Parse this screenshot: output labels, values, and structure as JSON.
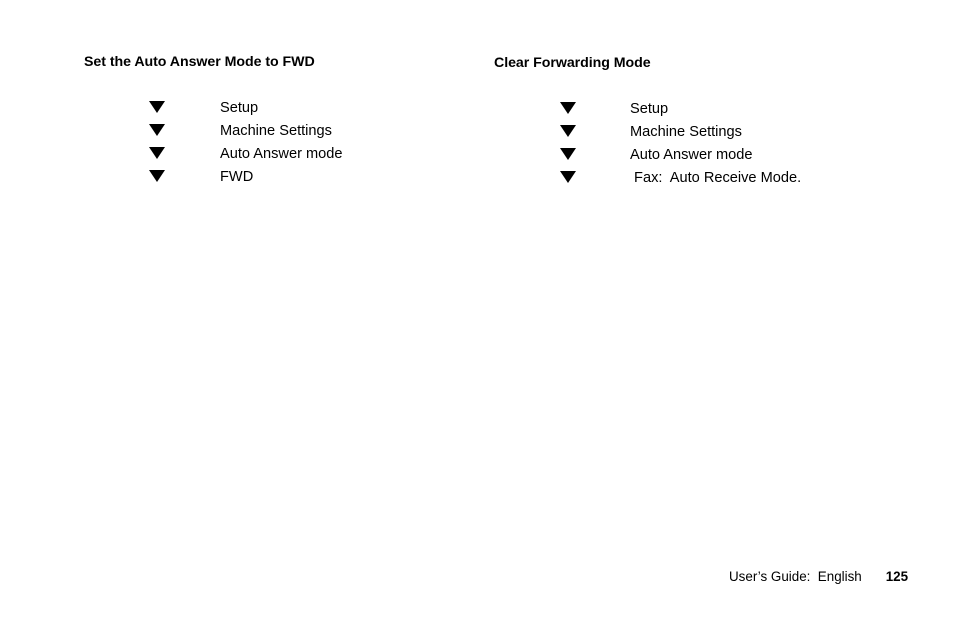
{
  "page": {
    "background_color": "#ffffff",
    "text_color": "#000000"
  },
  "sections": [
    {
      "heading": "Set the Auto Answer Mode to FWD",
      "steps": [
        {
          "marker": "down-triangle-icon",
          "label": "Setup"
        },
        {
          "marker": "down-triangle-icon",
          "label": "Machine Settings"
        },
        {
          "marker": "down-triangle-icon",
          "label": "Auto Answer mode"
        },
        {
          "marker": "down-triangle-icon",
          "label": "FWD"
        }
      ]
    },
    {
      "heading": "Clear Forwarding Mode",
      "steps": [
        {
          "marker": "down-triangle-icon",
          "label": "Setup"
        },
        {
          "marker": "down-triangle-icon",
          "label": "Machine Settings"
        },
        {
          "marker": "down-triangle-icon",
          "label": "Auto Answer mode"
        },
        {
          "marker": "down-triangle-icon",
          "label": " Fax:  Auto Receive Mode."
        }
      ]
    }
  ],
  "footer": {
    "guide_text": "User’s Guide:  English",
    "page_number": "125"
  }
}
